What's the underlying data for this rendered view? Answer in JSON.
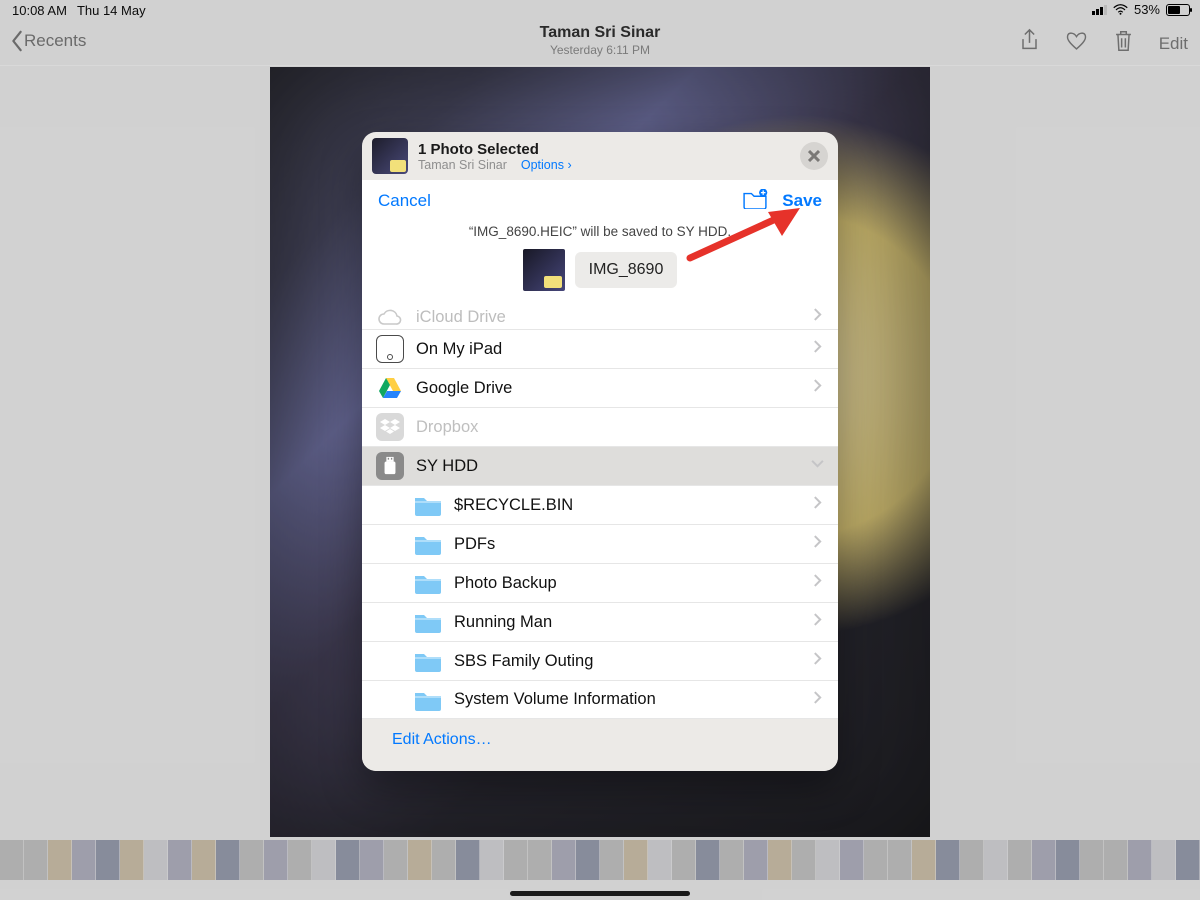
{
  "status": {
    "time": "10:08 AM",
    "date": "Thu 14 May",
    "battery": "53%"
  },
  "nav": {
    "back_label": "Recents",
    "title": "Taman Sri Sinar",
    "subtitle": "Yesterday  6:11 PM",
    "edit_label": "Edit"
  },
  "share_header": {
    "title": "1 Photo Selected",
    "location": "Taman Sri Sinar",
    "options_label": "Options",
    "options_chevron": "›"
  },
  "save_sheet": {
    "cancel": "Cancel",
    "save": "Save",
    "message": "“IMG_8690.HEIC” will be saved to SY HDD.",
    "filename": "IMG_8690"
  },
  "locations": {
    "icloud": "iCloud Drive",
    "onipad": "On My iPad",
    "gdrive": "Google Drive",
    "dropbox": "Dropbox",
    "syhdd": "SY HDD"
  },
  "folders": [
    "$RECYCLE.BIN",
    "PDFs",
    "Photo Backup",
    "Running Man",
    "SBS Family Outing",
    "System Volume Information"
  ],
  "edit_actions": "Edit Actions…"
}
